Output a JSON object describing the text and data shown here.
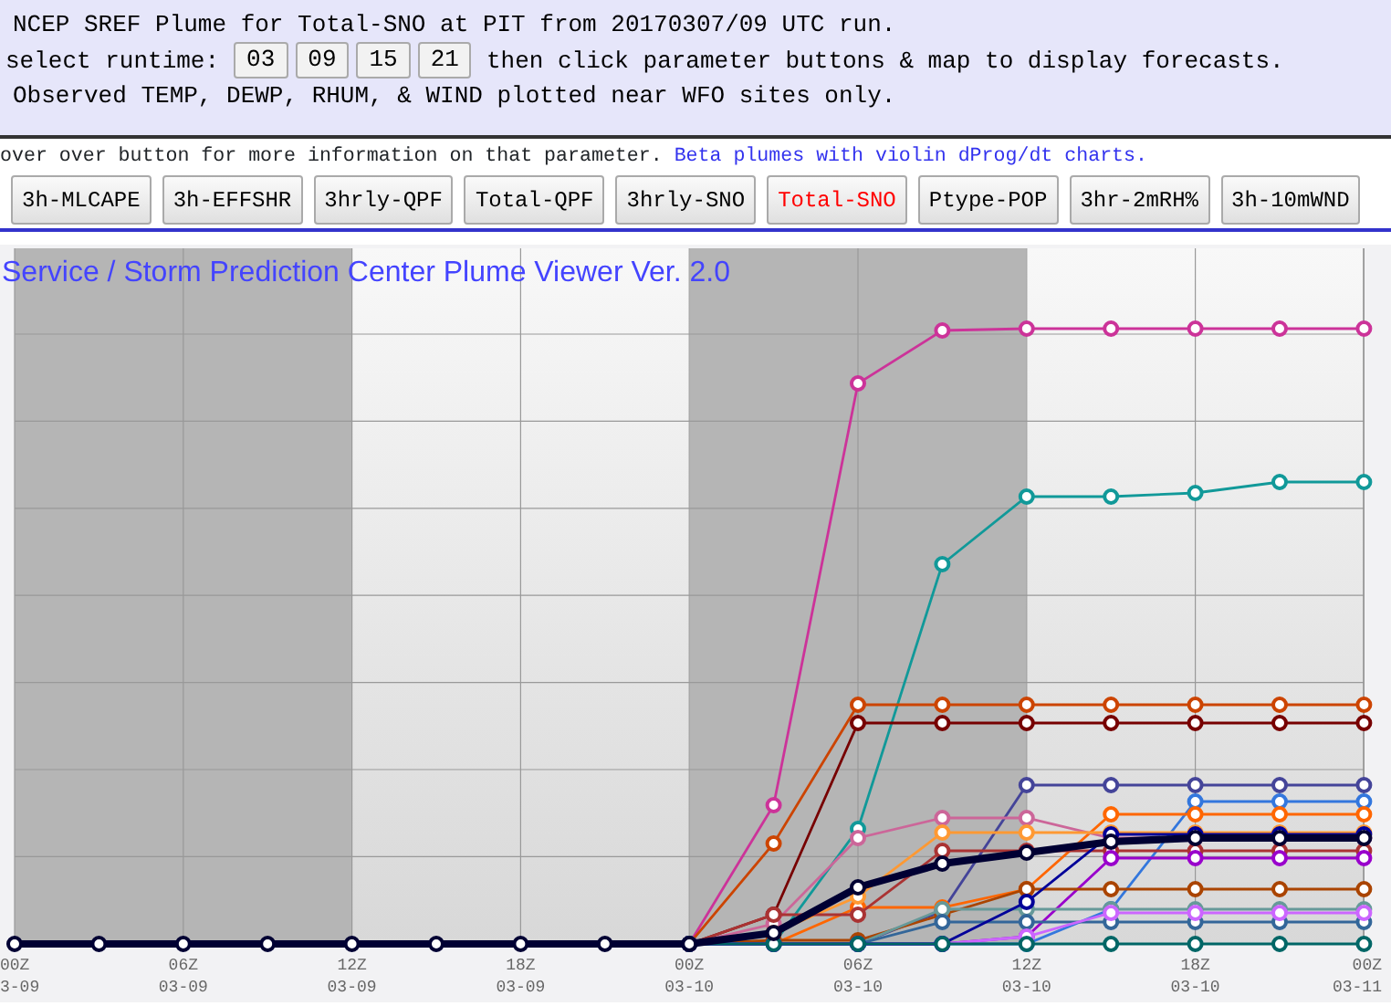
{
  "header": {
    "title_line": "NCEP SREF Plume for Total-SNO at PIT from 20170307/09 UTC run.",
    "runtime_label": "select runtime:",
    "runtime_buttons": [
      "03",
      "09",
      "15",
      "21"
    ],
    "runtime_note": "then click parameter buttons & map to display forecasts.",
    "note_line": "Observed TEMP, DEWP, RHUM, & WIND plotted near WFO sites only."
  },
  "info": {
    "text": "over over button for more information on that parameter.",
    "link": "Beta plumes with violin dProg/dt charts."
  },
  "parameter_buttons": [
    {
      "label": "3h-MLCAPE",
      "selected": false
    },
    {
      "label": "3h-EFFSHR",
      "selected": false
    },
    {
      "label": "3hrly-QPF",
      "selected": false
    },
    {
      "label": "Total-QPF",
      "selected": false
    },
    {
      "label": "3hrly-SNO",
      "selected": false
    },
    {
      "label": "Total-SNO",
      "selected": true
    },
    {
      "label": "Ptype-POP",
      "selected": false
    },
    {
      "label": "3hr-2mRH%",
      "selected": false
    },
    {
      "label": "3h-10mWND",
      "selected": false
    }
  ],
  "chart": {
    "title": "Service / Storm Prediction Center Plume Viewer Ver. 2.0",
    "x_labels": [
      {
        "time": "00Z",
        "date": "3-09"
      },
      {
        "time": "06Z",
        "date": "03-09"
      },
      {
        "time": "12Z",
        "date": "03-09"
      },
      {
        "time": "18Z",
        "date": "03-09"
      },
      {
        "time": "00Z",
        "date": "03-10"
      },
      {
        "time": "06Z",
        "date": "03-10"
      },
      {
        "time": "12Z",
        "date": "03-10"
      },
      {
        "time": "18Z",
        "date": "03-10"
      },
      {
        "time": "00Z",
        "date": "03-11"
      }
    ]
  }
}
